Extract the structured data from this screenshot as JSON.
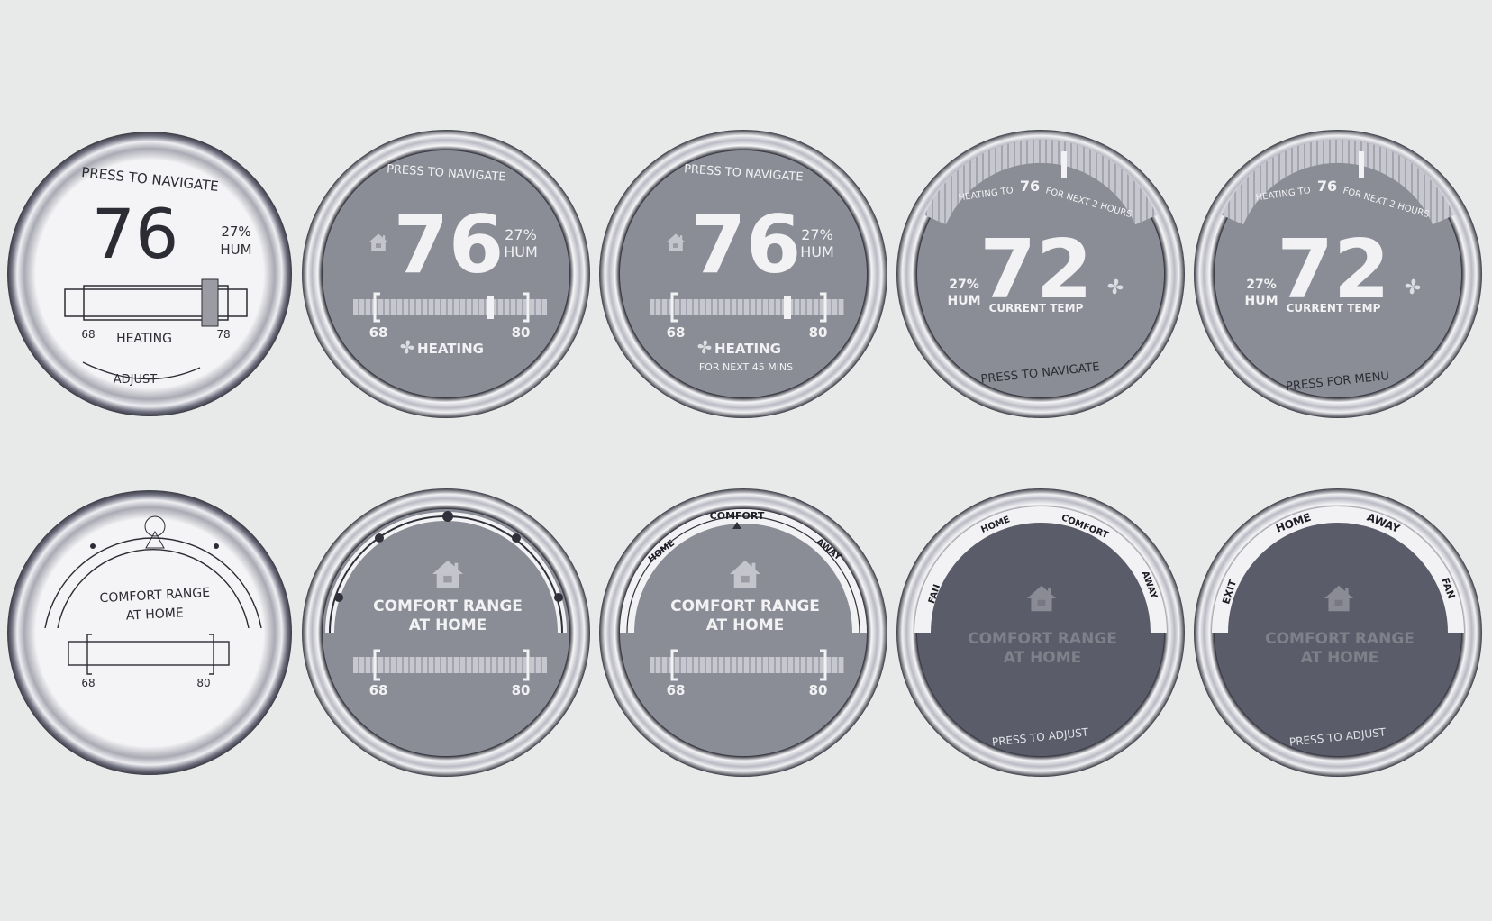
{
  "colors": {
    "background": "#e8eae9",
    "ring_dark": "#383842",
    "ring_light": "#f4f4f6",
    "face_light": "#8b8d96",
    "face_dark": "#5a5c69",
    "text": "#f2f2f4",
    "dim_text": "#7e808a",
    "sketch_ink": "#2c2c34"
  },
  "row1": {
    "sketch": {
      "hint": "PRESS TO NAVIGATE",
      "temp": "76",
      "hum_pct": "27%",
      "hum_label": "HUM",
      "low": "68",
      "mode": "HEATING",
      "high": "78",
      "adjust": "ADJUST"
    },
    "screen2": {
      "hint": "PRESS TO NAVIGATE",
      "temp": "76",
      "hum_pct": "27%",
      "hum_label": "HUM",
      "low": "68",
      "high": "80",
      "mode": "HEATING",
      "icon": "home-icon",
      "fan_icon": "fan-icon"
    },
    "screen3": {
      "hint": "PRESS TO NAVIGATE",
      "temp": "76",
      "hum_pct": "27%",
      "hum_label": "HUM",
      "low": "68",
      "high": "80",
      "mode": "HEATING",
      "sub": "FOR NEXT 45 MINS"
    },
    "screen4": {
      "arc_prefix": "HEATING TO",
      "target": "76",
      "arc_suffix": "FOR NEXT 2 HOURS",
      "temp": "72",
      "temp_label": "CURRENT TEMP",
      "hum_pct": "27%",
      "hum_label": "HUM",
      "bottom": "PRESS TO NAVIGATE"
    },
    "screen5": {
      "arc_prefix": "HEATING TO",
      "target": "76",
      "arc_suffix": "FOR NEXT 2 HOURS",
      "temp": "72",
      "temp_label": "CURRENT TEMP",
      "hum_pct": "27%",
      "hum_label": "HUM",
      "bottom": "PRESS FOR MENU"
    }
  },
  "row2": {
    "sketch": {
      "line1": "COMFORT RANGE",
      "line2": "AT HOME",
      "low": "68",
      "high": "80"
    },
    "screen2": {
      "line1": "COMFORT RANGE",
      "line2": "AT HOME",
      "low": "68",
      "high": "80"
    },
    "screen3": {
      "line1": "COMFORT RANGE",
      "line2": "AT HOME",
      "low": "68",
      "high": "80",
      "menu": [
        "HOME",
        "COMFORT",
        "AWAY"
      ]
    },
    "screen4": {
      "line1": "COMFORT RANGE",
      "line2": "AT HOME",
      "bottom": "PRESS TO ADJUST",
      "menu": [
        "FAN",
        "HOME",
        "COMFORT",
        "AWAY"
      ]
    },
    "screen5": {
      "line1": "COMFORT RANGE",
      "line2": "AT HOME",
      "bottom": "PRESS TO ADJUST",
      "menu": [
        "EXIT",
        "HOME",
        "AWAY",
        "FAN"
      ]
    }
  }
}
